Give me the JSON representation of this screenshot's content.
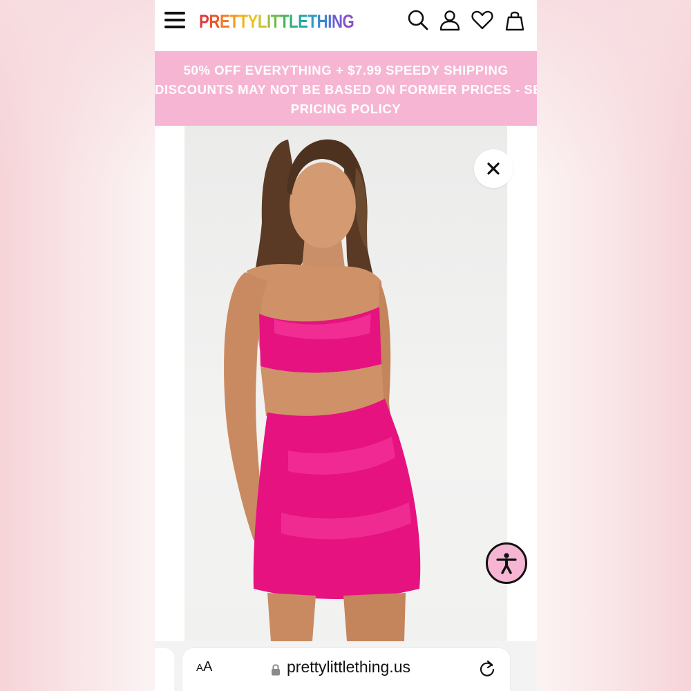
{
  "header": {
    "logo_letters": [
      {
        "ch": "P",
        "color": "#e03a3e"
      },
      {
        "ch": "R",
        "color": "#e8572c"
      },
      {
        "ch": "E",
        "color": "#f07a26"
      },
      {
        "ch": "T",
        "color": "#f39a1f"
      },
      {
        "ch": "T",
        "color": "#f2b318"
      },
      {
        "ch": "Y",
        "color": "#e9c21b"
      },
      {
        "ch": "L",
        "color": "#c9c52a"
      },
      {
        "ch": "I",
        "color": "#9dc13a"
      },
      {
        "ch": "T",
        "color": "#6fba45"
      },
      {
        "ch": "T",
        "color": "#47b35a"
      },
      {
        "ch": "L",
        "color": "#2fae7c"
      },
      {
        "ch": "E",
        "color": "#23a8a3"
      },
      {
        "ch": "T",
        "color": "#2a9bc6"
      },
      {
        "ch": "H",
        "color": "#3a86d4"
      },
      {
        "ch": "I",
        "color": "#5470d6"
      },
      {
        "ch": "N",
        "color": "#6e5dd2"
      },
      {
        "ch": "G",
        "color": "#8a4fc9"
      }
    ],
    "icons": [
      "menu-icon",
      "search-icon",
      "account-icon",
      "wishlist-icon",
      "bag-icon"
    ]
  },
  "promo": {
    "line1": "50% OFF EVERYTHING + $7.99 SPEEDY SHIPPING",
    "line2": "DISCOUNTS MAY NOT BE BASED ON FORMER PRICES - SEE",
    "line3": "PRICING POLICY",
    "bg_color": "#f6b6d3"
  },
  "product": {
    "close_icon": "close-icon",
    "accessibility_icon": "accessibility-icon"
  },
  "browser": {
    "text_size_big": "A",
    "text_size_small": "A",
    "url": "prettylittlething.us",
    "lock_icon": "lock-icon",
    "reload_icon": "reload-icon"
  },
  "colors": {
    "promo_pink": "#f6b6d3",
    "product_pink": "#e6127f"
  }
}
